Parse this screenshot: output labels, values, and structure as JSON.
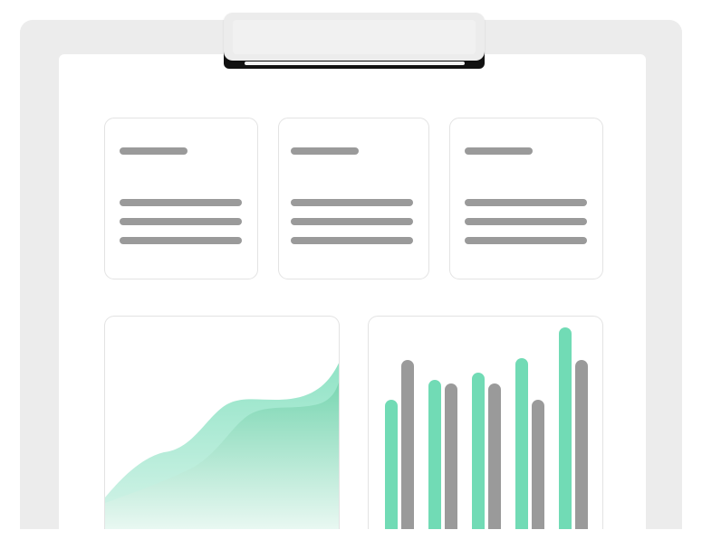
{
  "colors": {
    "board": "#ececec",
    "paper": "#ffffff",
    "placeholder_line": "#9a9a9a",
    "accent_green": "#71dbb5",
    "bar_gray": "#9a9a9a"
  },
  "info_cards": [
    {
      "heading_lines": 1,
      "body_lines": 3
    },
    {
      "heading_lines": 1,
      "body_lines": 3
    },
    {
      "heading_lines": 1,
      "body_lines": 3
    }
  ],
  "chart_data": [
    {
      "type": "area",
      "title": "",
      "series": [
        {
          "values": [
            0.12,
            0.3,
            0.48,
            0.52,
            0.69,
            0.84,
            0.95,
            1.0
          ]
        }
      ]
    },
    {
      "type": "bar",
      "title": "",
      "categories": [
        "",
        "",
        "",
        "",
        ""
      ],
      "series": [
        {
          "values": [
            62,
            73,
            77,
            85,
            102
          ]
        },
        {
          "values": [
            84,
            71,
            71,
            62,
            84
          ]
        }
      ],
      "ylim": [
        0,
        110
      ]
    }
  ]
}
